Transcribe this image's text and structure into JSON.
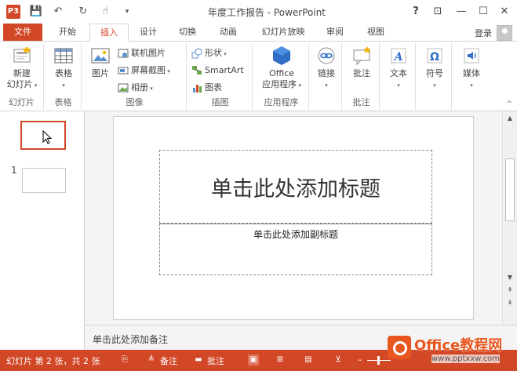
{
  "window": {
    "title": "年度工作报告 - PowerPoint",
    "app_icon_label": "P3",
    "help": "?",
    "controls": {
      "ribbon_options": "⊡",
      "minimize": "—",
      "maximize": "☐",
      "close": "✕"
    }
  },
  "qat": {
    "save": "💾",
    "undo": "↶",
    "redo": "↻",
    "touch": "☝",
    "customize": "▾"
  },
  "tabs": [
    {
      "label": "文件"
    },
    {
      "label": "开始"
    },
    {
      "label": "插入"
    },
    {
      "label": "设计"
    },
    {
      "label": "切换"
    },
    {
      "label": "动画"
    },
    {
      "label": "幻灯片放映"
    },
    {
      "label": "审阅"
    },
    {
      "label": "视图"
    }
  ],
  "account": {
    "login": "登录"
  },
  "ribbon": {
    "slides": {
      "new_slide_1": "新建",
      "new_slide_2": "幻灯片",
      "group": "幻灯片"
    },
    "tables": {
      "table": "表格",
      "group": "表格"
    },
    "images": {
      "pictures": "图片",
      "online_pictures": "联机图片",
      "screenshot": "屏幕截图",
      "photo_album": "相册",
      "group": "图像"
    },
    "illustrations": {
      "shapes": "形状",
      "smartart": "SmartArt",
      "chart": "图表",
      "group": "插图"
    },
    "apps": {
      "office_1": "Office",
      "office_2": "应用程序",
      "group": "应用程序"
    },
    "links": {
      "link": "链接"
    },
    "comments": {
      "comment": "批注",
      "group": "批注"
    },
    "text": {
      "text": "文本"
    },
    "symbols": {
      "symbol": "符号"
    },
    "media": {
      "media": "媒体"
    }
  },
  "thumbnails": {
    "slide2_number": "1"
  },
  "slide": {
    "title_placeholder": "单击此处添加标题",
    "subtitle_placeholder": "单击此处添加副标题"
  },
  "notes": {
    "placeholder": "单击此处添加备注"
  },
  "status": {
    "slide_info": "幻灯片 第 2 张，共 2 张",
    "notes": "备注",
    "comments": "批注"
  },
  "watermark": {
    "main": "Office教程网",
    "sub": "www.pptxxw.com"
  },
  "colors": {
    "accent": "#d24726"
  }
}
